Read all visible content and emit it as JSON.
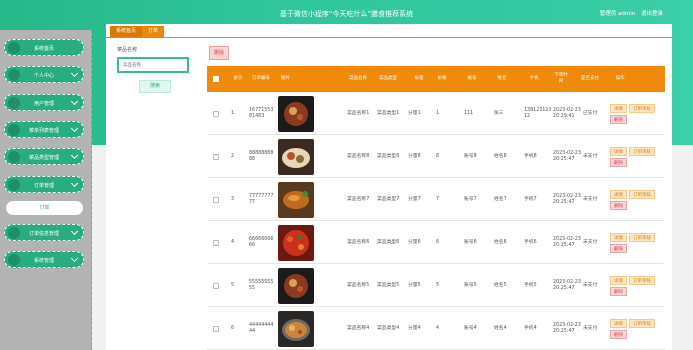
{
  "header": {
    "title": "基于微信小程序“今天吃什么”膳食推荐系统",
    "welcome": "管理员 admin",
    "logout": "退出登录"
  },
  "colors": {
    "primary": "#2fc69b",
    "accent": "#ef8a0a",
    "danger": "#d44444"
  },
  "sidebar": {
    "items": [
      {
        "label": "系统首页"
      },
      {
        "label": "个人中心"
      },
      {
        "label": "用户管理"
      },
      {
        "label": "菜单列表管理"
      },
      {
        "label": "菜品类型管理"
      },
      {
        "label": "订单管理"
      },
      {
        "label": "订单信息管理"
      },
      {
        "label": "系统管理"
      }
    ],
    "sub_item": "订单"
  },
  "tabs": {
    "home": "系统首页",
    "current": "订单"
  },
  "search": {
    "label": "菜品名称",
    "placeholder": "菜品名称",
    "button": "搜索"
  },
  "toolbar": {
    "delete": "删除"
  },
  "table": {
    "headers": [
      "索引",
      "订单编号",
      "图片",
      "菜品名称",
      "菜品类型",
      "份量",
      "价格",
      "账号",
      "姓名",
      "手机",
      "下单时间",
      "是否支付",
      "操作"
    ],
    "actions": {
      "detail": "详情",
      "review": "订单审核",
      "delete": "删除"
    },
    "rows": [
      {
        "index": "1",
        "order_no": "1677155381483",
        "dish": "菜品名称1",
        "type": "菜品类型1",
        "portion": "分量1",
        "price": "1",
        "account": "111",
        "name": "张三",
        "phone": "13812312312",
        "time": "2023-02-23 20:29:41",
        "paid": "已支付",
        "image": "dish-dark-bowl-icon"
      },
      {
        "index": "2",
        "order_no": "8888888888",
        "dish": "菜品名称8",
        "type": "菜品类型8",
        "portion": "分量8",
        "price": "8",
        "account": "账号8",
        "name": "姓名8",
        "phone": "手机8",
        "time": "2023-02-23 20:25:47",
        "paid": "未支付",
        "image": "dish-platter-icon"
      },
      {
        "index": "3",
        "order_no": "7777777777",
        "dish": "菜品名称7",
        "type": "菜品类型7",
        "portion": "分量7",
        "price": "7",
        "account": "账号7",
        "name": "姓名7",
        "phone": "手机7",
        "time": "2023-02-23 20:25:47",
        "paid": "未支付",
        "image": "roast-duck-icon"
      },
      {
        "index": "4",
        "order_no": "6666666666",
        "dish": "菜品名称6",
        "type": "菜品类型6",
        "portion": "分量6",
        "price": "6",
        "account": "账号6",
        "name": "姓名6",
        "phone": "手机6",
        "time": "2023-02-23 20:25:47",
        "paid": "未支付",
        "image": "chili-crayfish-icon"
      },
      {
        "index": "5",
        "order_no": "5555555555",
        "dish": "菜品名称5",
        "type": "菜品类型5",
        "portion": "分量5",
        "price": "5",
        "account": "账号5",
        "name": "姓名5",
        "phone": "手机5",
        "time": "2023-02-23 20:25:47",
        "paid": "未支付",
        "image": "dish-dark-bowl-icon"
      },
      {
        "index": "6",
        "order_no": "4444444444",
        "dish": "菜品名称4",
        "type": "菜品类型4",
        "portion": "分量4",
        "price": "4",
        "account": "账号4",
        "name": "姓名4",
        "phone": "手机4",
        "time": "2023-02-23 20:25:47",
        "paid": "未支付",
        "image": "hotpot-icon"
      }
    ]
  }
}
